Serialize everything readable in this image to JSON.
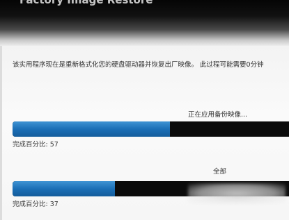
{
  "window": {
    "title": "Factory Image Restore"
  },
  "description": "该实用程序现在是重新格式化您的硬盘驱动器并恢复出厂映像。 此过程可能需要0分钟",
  "tasks": [
    {
      "status": "正在应用备份映像...",
      "percent_label": "完成百分比: 57",
      "progress": 0.57
    },
    {
      "status": "全部",
      "percent_label": "完成百分比: 37",
      "progress": 0.37
    }
  ],
  "colors": {
    "progress_fill": "#1b6fb6",
    "progress_track": "#0b0b0b",
    "title_bar": "#050505"
  }
}
